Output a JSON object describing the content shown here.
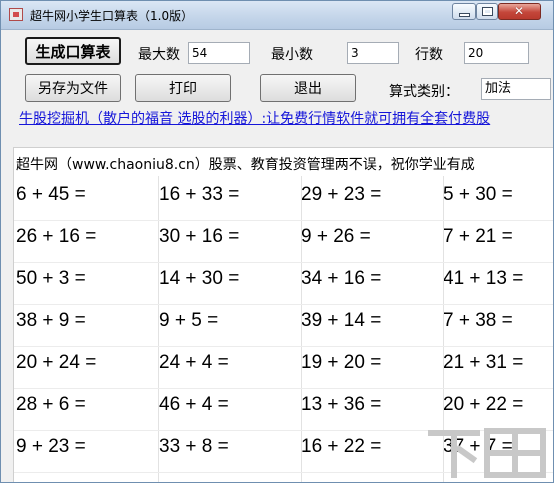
{
  "window": {
    "title": "超牛网小学生口算表（1.0版）"
  },
  "toolbar": {
    "generate_label": "生成口算表",
    "saveas_label": "另存为文件",
    "print_label": "打印",
    "exit_label": "退出",
    "max_label": "最大数",
    "max_value": "54",
    "min_label": "最小数",
    "min_value": "3",
    "rows_label": "行数",
    "rows_value": "20",
    "type_label": "算式类别：",
    "type_value": "加法"
  },
  "promo_link": "牛股挖掘机（散户的福音 选股的利器）:让免费行情软件就可拥有全套付费股",
  "sheet": {
    "header": "超牛网（www.chaoniu8.cn）股票、教育投资管理两不误，祝你学业有成",
    "rows": [
      [
        "6 + 45 =",
        "16 + 33 =",
        "29 + 23 =",
        "5 + 30 ="
      ],
      [
        "26 + 16 =",
        "30 + 16 =",
        "9 + 26 =",
        "7 + 21 ="
      ],
      [
        "50 + 3 =",
        "14 + 30 =",
        "34 + 16 =",
        "41 + 13 ="
      ],
      [
        "38 + 9 =",
        "9 + 5 =",
        "39 + 14 =",
        "7 + 38 ="
      ],
      [
        "20 + 24 =",
        "24 + 4 =",
        "19 + 20 =",
        "21 + 31 ="
      ],
      [
        "28 + 6 =",
        "46 + 4 =",
        "13 + 36 =",
        "20 + 22 ="
      ],
      [
        "9 + 23 =",
        "33 + 8 =",
        "16 + 22 =",
        "37 + 7 ="
      ]
    ]
  }
}
